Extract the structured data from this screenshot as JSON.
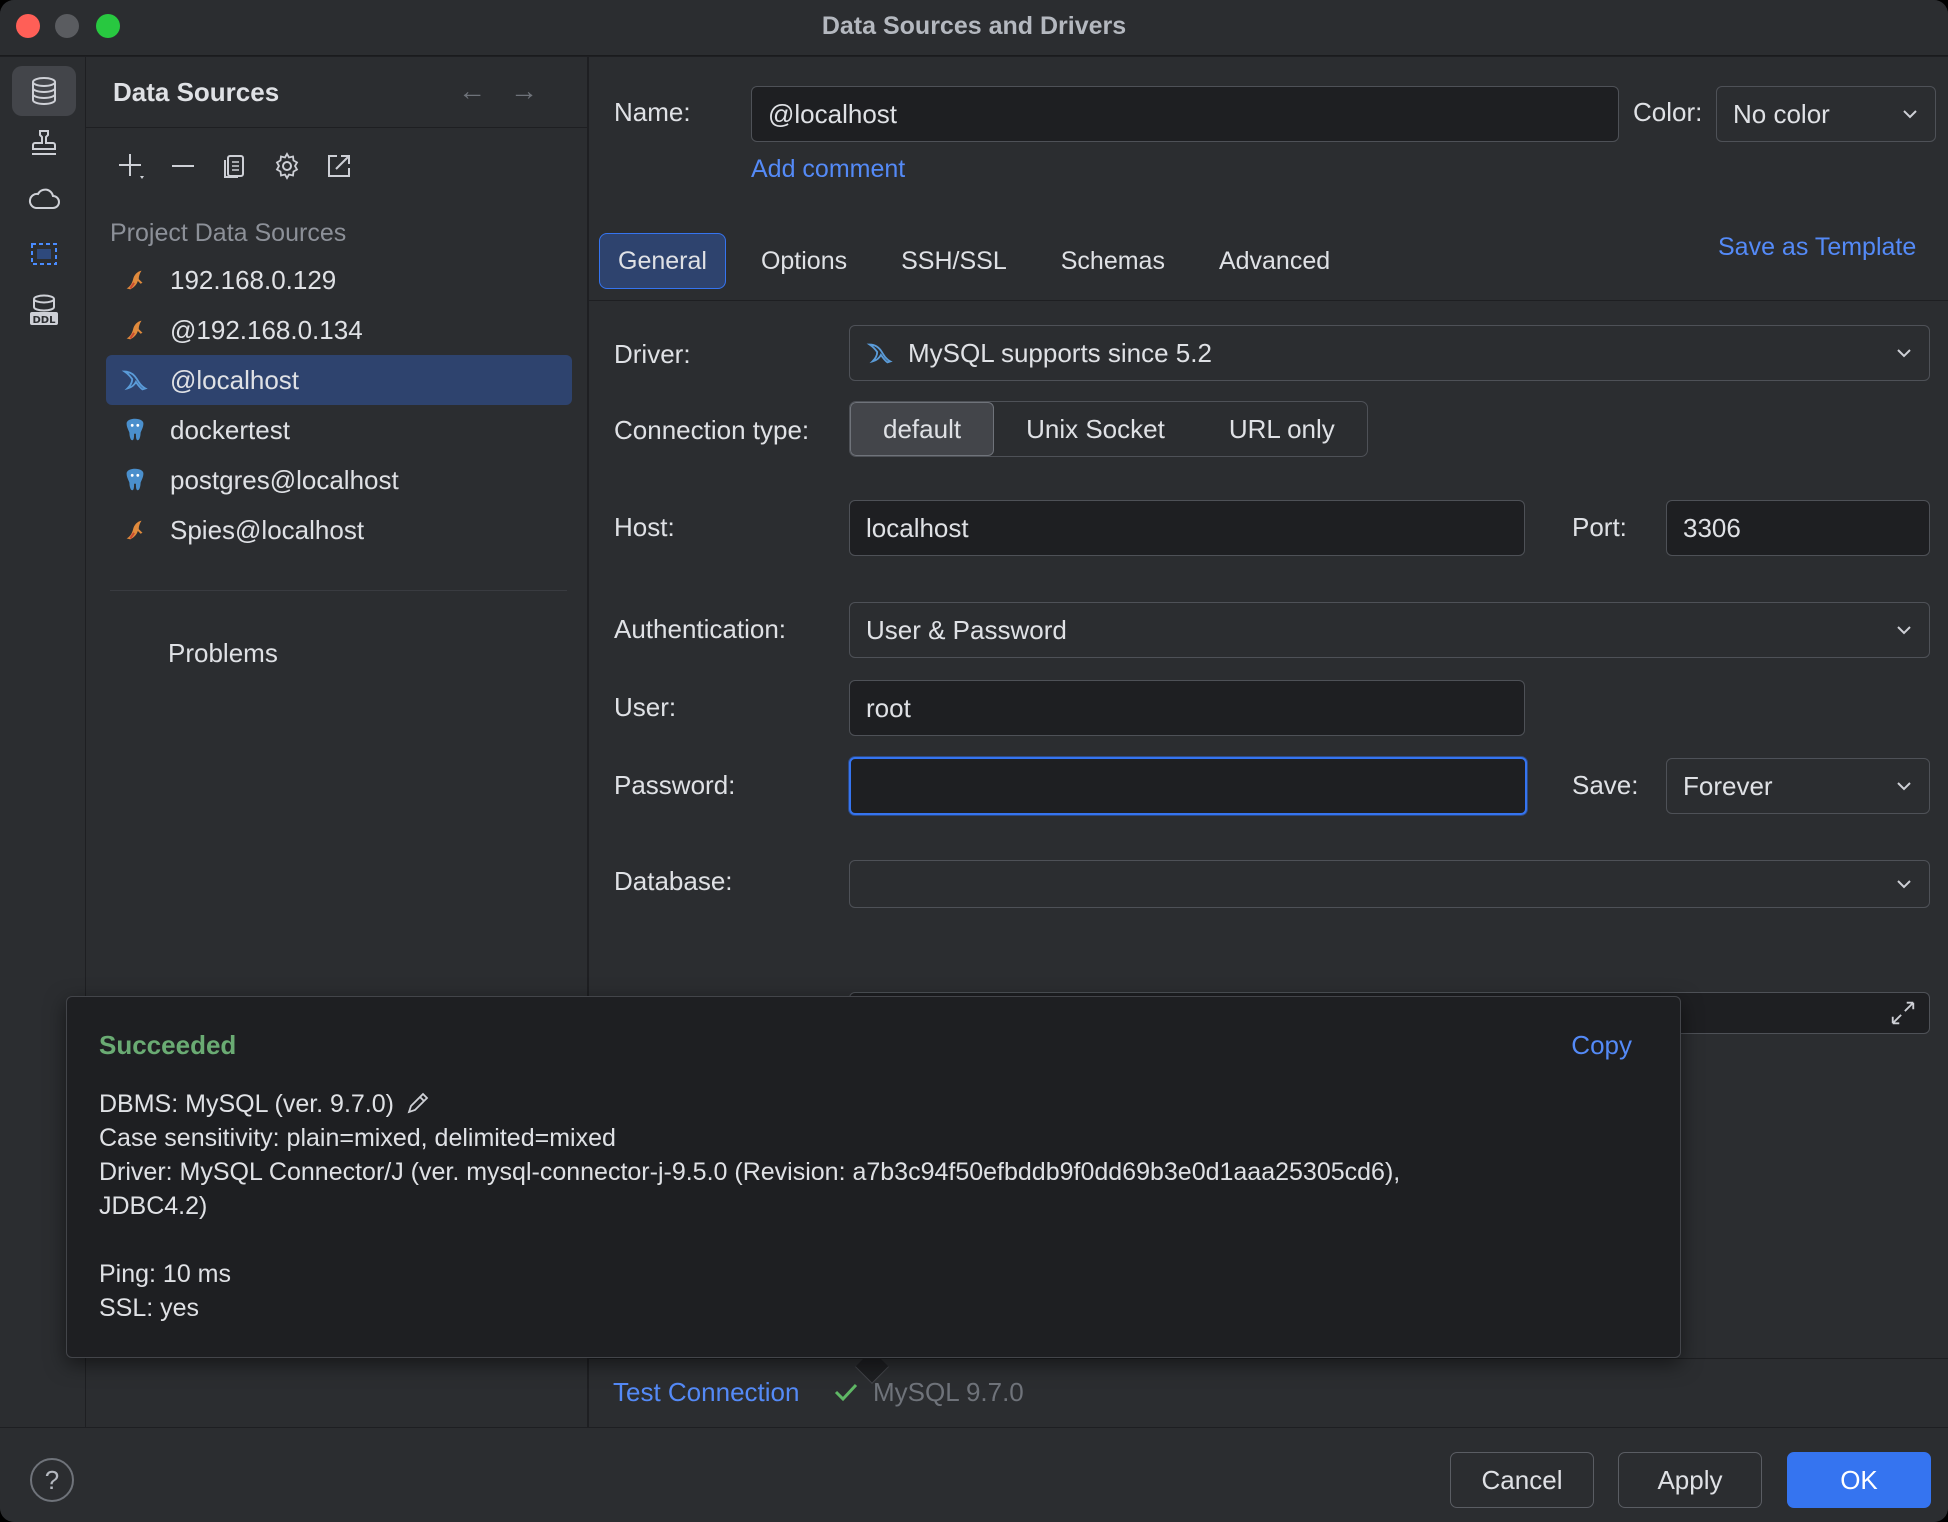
{
  "window": {
    "title": "Data Sources and Drivers"
  },
  "sidebar": {
    "title": "Data Sources",
    "group_label": "Project Data Sources",
    "items": [
      {
        "label": "192.168.0.129",
        "icon": "mysql-icon"
      },
      {
        "label": "@192.168.0.134",
        "icon": "mysql-icon"
      },
      {
        "label": "@localhost",
        "icon": "mysql-icon",
        "selected": true
      },
      {
        "label": "dockertest",
        "icon": "postgres-icon"
      },
      {
        "label": "postgres@localhost",
        "icon": "postgres-icon"
      },
      {
        "label": "Spies@localhost",
        "icon": "mysql-icon"
      }
    ],
    "problems_label": "Problems"
  },
  "form": {
    "name_label": "Name:",
    "name_value": "@localhost",
    "color_label": "Color:",
    "color_value": "No color",
    "add_comment": "Add comment",
    "save_template": "Save as Template",
    "tabs": [
      {
        "label": "General",
        "active": true
      },
      {
        "label": "Options"
      },
      {
        "label": "SSH/SSL"
      },
      {
        "label": "Schemas"
      },
      {
        "label": "Advanced"
      }
    ],
    "driver_label": "Driver:",
    "driver_value": "MySQL supports since 5.2",
    "conn_type_label": "Connection type:",
    "conn_types": [
      "default",
      "Unix Socket",
      "URL only"
    ],
    "host_label": "Host:",
    "host_value": "localhost",
    "port_label": "Port:",
    "port_value": "3306",
    "auth_label": "Authentication:",
    "auth_value": "User & Password",
    "user_label": "User:",
    "user_value": "root",
    "password_label": "Password:",
    "password_value": "",
    "save_label": "Save:",
    "save_value": "Forever",
    "database_label": "Database:",
    "database_value": ""
  },
  "popup": {
    "status": "Succeeded",
    "copy": "Copy",
    "dbms": "DBMS: MySQL (ver. 9.7.0)",
    "case_sensitivity": "Case sensitivity: plain=mixed, delimited=mixed",
    "driver_line1": "Driver: MySQL Connector/J (ver. mysql-connector-j-9.5.0 (Revision: a7b3c94f50efbddb9f0dd69b3e0d1aaa25305cd6),",
    "driver_line2": "JDBC4.2)",
    "ping": "Ping: 10 ms",
    "ssl": "SSL: yes"
  },
  "test": {
    "link": "Test Connection",
    "version": "MySQL 9.7.0"
  },
  "footer": {
    "help": "?",
    "cancel": "Cancel",
    "apply": "Apply",
    "ok": "OK"
  },
  "colors": {
    "accent": "#3574f0",
    "link": "#548af7",
    "success": "#6aab73",
    "selection": "#2e436e"
  }
}
